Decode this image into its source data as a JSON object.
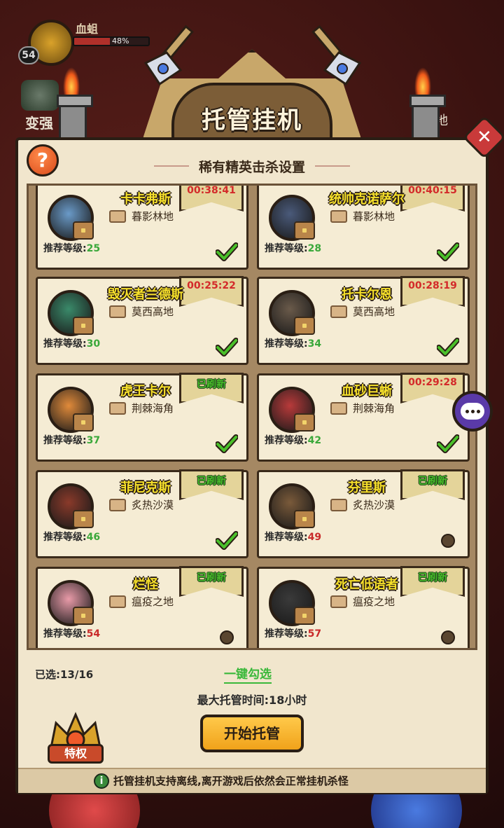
{
  "hud": {
    "player_level": "54",
    "player_name": "血蛆",
    "hp_text": "48%",
    "hp_fraction": 0.48,
    "left_label": "变强",
    "right_label": "地"
  },
  "dialog": {
    "title": "托管挂机",
    "section_title": "稀有精英击杀设置",
    "help_label": "?",
    "close_label": "✕",
    "rec_label": "推荐等级:"
  },
  "elites": [
    {
      "name": "卡卡弗斯",
      "location": "暮影林地",
      "level": "25",
      "level_color": "green",
      "status_type": "timer",
      "status": "00:38:41",
      "selected": true,
      "avatar_color": "#6a9ac8"
    },
    {
      "name": "统帅克诺萨尔",
      "location": "暮影林地",
      "level": "28",
      "level_color": "green",
      "status_type": "timer",
      "status": "00:40:15",
      "selected": true,
      "avatar_color": "#4a5a7a"
    },
    {
      "name": "毁灭者兰德斯",
      "location": "莫西高地",
      "level": "30",
      "level_color": "green",
      "status_type": "timer",
      "status": "00:25:22",
      "selected": true,
      "avatar_color": "#3a8a6a"
    },
    {
      "name": "托卡尔恩",
      "location": "莫西高地",
      "level": "34",
      "level_color": "green",
      "status_type": "timer",
      "status": "00:28:19",
      "selected": true,
      "avatar_color": "#6a5a4a"
    },
    {
      "name": "虎王卡尔",
      "location": "荆棘海角",
      "level": "37",
      "level_color": "green",
      "status_type": "refreshed",
      "status": "已刷新",
      "selected": true,
      "avatar_color": "#e08a3a"
    },
    {
      "name": "血砂巨蜥",
      "location": "荆棘海角",
      "level": "42",
      "level_color": "green",
      "status_type": "timer",
      "status": "00:29:28",
      "selected": true,
      "avatar_color": "#b83a3a"
    },
    {
      "name": "菲尼克斯",
      "location": "炙热沙漠",
      "level": "46",
      "level_color": "green",
      "status_type": "refreshed",
      "status": "已刷新",
      "selected": true,
      "avatar_color": "#8a3a2a"
    },
    {
      "name": "芬里斯",
      "location": "炙热沙漠",
      "level": "49",
      "level_color": "red",
      "status_type": "refreshed",
      "status": "已刷新",
      "selected": false,
      "avatar_color": "#7a5a3a"
    },
    {
      "name": "烂怪",
      "location": "瘟疫之地",
      "level": "54",
      "level_color": "red",
      "status_type": "refreshed",
      "status": "已刷新",
      "selected": false,
      "avatar_color": "#e89aa8"
    },
    {
      "name": "死亡低语者",
      "location": "瘟疫之地",
      "level": "57",
      "level_color": "red",
      "status_type": "refreshed",
      "status": "已刷新",
      "selected": false,
      "avatar_color": "#3a3a3a"
    }
  ],
  "footer": {
    "selected_count": "已选:13/16",
    "select_all": "一键勾选",
    "max_time": "最大托管时间:18小时",
    "start_button": "开始托管",
    "privilege_label": "特权",
    "tip_icon": "i",
    "tip": "托管挂机支持离线,离开游戏后依然会正常挂机杀怪"
  },
  "colors": {
    "timer": "#d32a2a",
    "refreshed": "#4ac02a",
    "level_green": "#3aa83a",
    "level_red": "#c92a2a",
    "name_yellow": "#f6e02a"
  },
  "icons": {
    "map": "scroll-map-icon",
    "chest": "treasure-chest-icon",
    "check": "green-check-icon",
    "chat": "chat-bubble-icon",
    "help": "question-mark-icon",
    "close": "close-x-icon",
    "info": "info-icon"
  }
}
